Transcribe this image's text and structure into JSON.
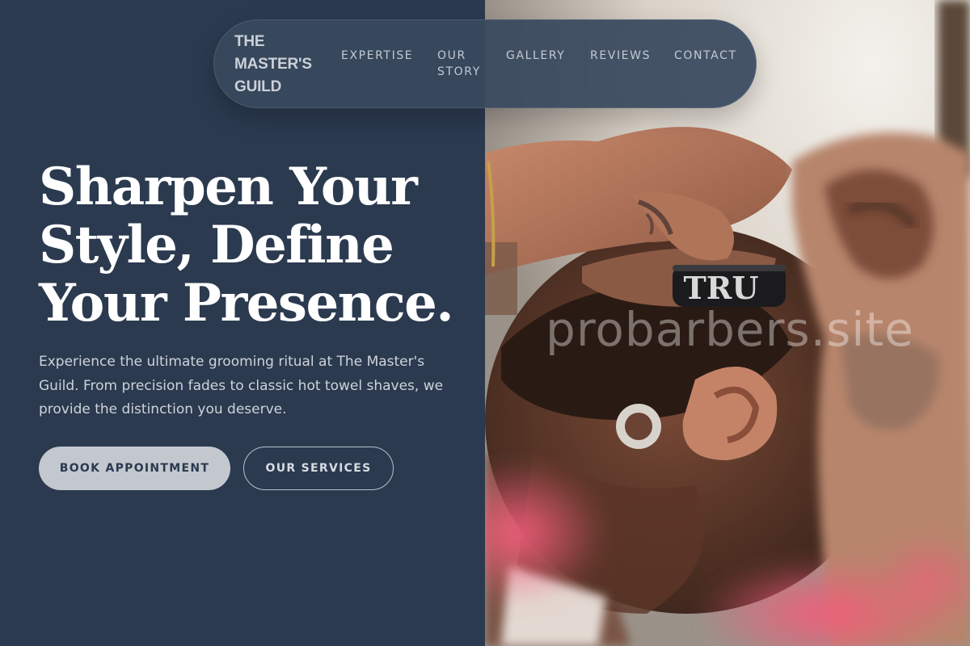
{
  "brand": {
    "name": "THE MASTER'S GUILD"
  },
  "nav": {
    "items": [
      {
        "label": "EXPERTISE"
      },
      {
        "label": "OUR STORY"
      },
      {
        "label": "GALLERY"
      },
      {
        "label": "REVIEWS"
      },
      {
        "label": "CONTACT"
      }
    ]
  },
  "hero": {
    "headline": "Sharpen Your Style, Define Your Presence.",
    "subtext": "Experience the ultimate grooming ritual at The Master's Guild. From precision fades to classic hot towel shaves, we provide the distinction you deserve.",
    "primary_cta": "BOOK APPOINTMENT",
    "secondary_cta": "OUR SERVICES"
  },
  "photo": {
    "razor_text": "TRU",
    "watermark": "probarbers.site"
  },
  "colors": {
    "panel": "#2b3a4f",
    "nav_bg": "#38485e",
    "primary_button": "#c3c8cf",
    "headline": "#ffffff"
  }
}
